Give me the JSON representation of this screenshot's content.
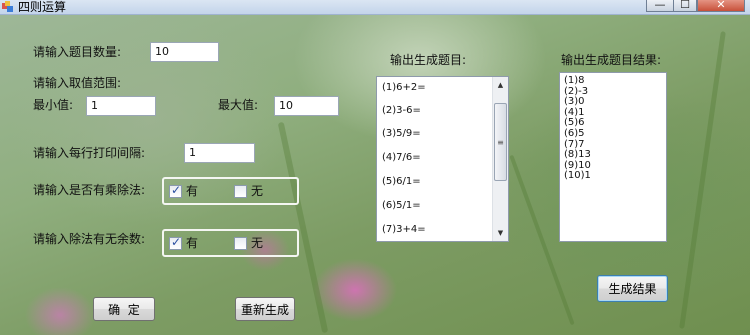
{
  "window": {
    "title": "四则运算",
    "minimize_glyph": "—",
    "maximize_glyph": "☐",
    "close_glyph": "✕"
  },
  "form": {
    "count_label": "请输入题目数量:",
    "count_value": "10",
    "range_label": "请输入取值范围:",
    "min_label": "最小值:",
    "min_value": "1",
    "max_label": "最大值:",
    "max_value": "10",
    "interval_label": "请输入每行打印间隔:",
    "interval_value": "1",
    "muldiv_label": "请输入是否有乘除法:",
    "muldiv_yes": "有",
    "muldiv_no": "无",
    "muldiv_yes_checked": true,
    "muldiv_no_checked": false,
    "remainder_label": "请输入除法有无余数:",
    "remainder_yes": "有",
    "remainder_no": "无",
    "remainder_yes_checked": true,
    "remainder_no_checked": false
  },
  "questions": {
    "label": "输出生成题目:",
    "items": [
      "(1)6+2=",
      "(2)3-6=",
      "(3)5/9=",
      "(4)7/6=",
      "(5)6/1=",
      "(6)5/1=",
      "(7)3+4="
    ]
  },
  "results": {
    "label": "输出生成题目结果:",
    "items": [
      "(1)8",
      "(2)-3",
      "(3)0",
      "(4)1",
      "(5)6",
      "(6)5",
      "(7)7",
      "(8)13",
      "(9)10",
      "(10)1"
    ]
  },
  "buttons": {
    "confirm": "确  定",
    "regenerate": "重新生成",
    "generate_results": "生成结果"
  }
}
